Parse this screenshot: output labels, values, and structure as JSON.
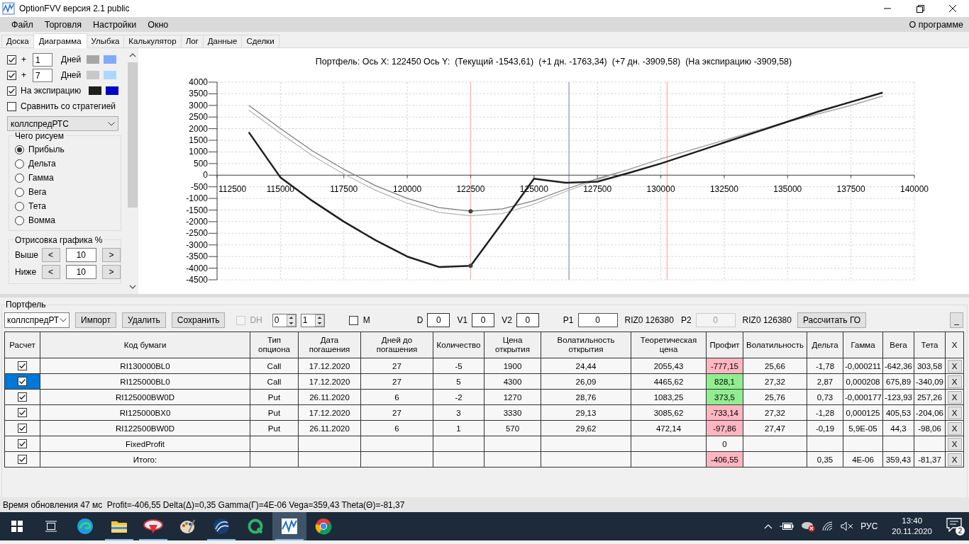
{
  "window": {
    "title": "OptionFVV версия 2.1 public"
  },
  "menu": {
    "items": [
      "Файл",
      "Торговля",
      "Настройки",
      "Окно"
    ],
    "about": "О программе"
  },
  "tabs": [
    {
      "label": "Доска",
      "selected": false
    },
    {
      "label": "Диаграмма",
      "selected": true
    },
    {
      "label": "Улыбка",
      "selected": false
    },
    {
      "label": "Калькулятор",
      "selected": false
    },
    {
      "label": "Лог",
      "selected": false
    },
    {
      "label": "Данные",
      "selected": false
    },
    {
      "label": "Сделки",
      "selected": false
    }
  ],
  "sidebar": {
    "horizons": [
      {
        "checked": true,
        "prefix": "+",
        "days": "1",
        "unit": "Дней",
        "swatches": [
          {
            "color": "#a6a6a6"
          },
          {
            "color": "#80aaff"
          }
        ]
      },
      {
        "checked": true,
        "prefix": "+",
        "days": "7",
        "unit": "Дней",
        "swatches": [
          {
            "color": "#c8c8c8"
          },
          {
            "color": "#aad8ff"
          }
        ]
      }
    ],
    "expiration": {
      "checked": true,
      "label": "На экспирацию",
      "swatches": [
        {
          "color": "#1e1e1e"
        },
        {
          "color": "#0000c8"
        }
      ]
    },
    "compare": {
      "checked": false,
      "label": "Сравнить со стратегией"
    },
    "strategy_select": {
      "value": "коллспредРТС"
    },
    "draw_group": {
      "title": "Чего рисуем",
      "options": [
        {
          "label": "Прибыль",
          "selected": true
        },
        {
          "label": "Дельта",
          "selected": false
        },
        {
          "label": "Гамма",
          "selected": false
        },
        {
          "label": "Вега",
          "selected": false
        },
        {
          "label": "Тета",
          "selected": false
        },
        {
          "label": "Вомма",
          "selected": false
        }
      ]
    },
    "range_group": {
      "title": "Отрисовка графика %",
      "rows": [
        {
          "label": "Выше",
          "dec": "<",
          "value": "10",
          "inc": ">"
        },
        {
          "label": "Ниже",
          "dec": "<",
          "value": "10",
          "inc": ">"
        }
      ]
    }
  },
  "chart": {
    "title": "Портфель: Ось X: 122450 Ось Y:  (Текущий -1543,61)  (+1 дн. -1763,34)  (+7 дн. -3909,58)  (На экспирацию -3909,58)",
    "chart_data": {
      "type": "line",
      "x": [
        113750,
        115000,
        116250,
        117500,
        118750,
        120000,
        121250,
        122500,
        123750,
        125000,
        126250,
        127500,
        128750,
        130000,
        131250,
        132500,
        133750,
        135000,
        136250,
        137500,
        138750
      ],
      "series": [
        {
          "color": "#7a7a7a",
          "values": [
            3000,
            2000,
            1050,
            250,
            -450,
            -1000,
            -1400,
            -1550,
            -1450,
            -1100,
            -600,
            -150,
            250,
            700,
            1100,
            1500,
            1900,
            2300,
            2650,
            3000,
            3400
          ]
        },
        {
          "color": "#b4b4b4",
          "values": [
            2800,
            1800,
            850,
            50,
            -650,
            -1200,
            -1600,
            -1750,
            -1650,
            -1250,
            -700,
            -200,
            250,
            700,
            1100,
            1500,
            1900,
            2300,
            2650,
            3000,
            3400
          ]
        },
        {
          "color": "#1e1e1e",
          "values": [
            1850,
            -100,
            -1100,
            -2000,
            -2800,
            -3500,
            -3950,
            -3900,
            -2050,
            -150,
            -330,
            -280,
            100,
            500,
            950,
            1400,
            1850,
            2300,
            2750,
            3150,
            3550
          ]
        }
      ],
      "xlim": [
        112500,
        140000
      ],
      "ylim": [
        -4500,
        4000
      ],
      "xticks": [
        112500,
        115000,
        117500,
        120000,
        122500,
        125000,
        127500,
        130000,
        132500,
        135000,
        137500,
        140000
      ],
      "yticks": [
        4000,
        3500,
        3000,
        2500,
        2000,
        1500,
        1000,
        500,
        0,
        -500,
        -1000,
        -1500,
        -2000,
        -2500,
        -3000,
        -3500,
        -4000,
        -4500
      ],
      "grid": true,
      "ref_lines": [
        {
          "axis": "x",
          "value": 122500,
          "color": "#ffb4b4"
        },
        {
          "axis": "x",
          "value": 126380,
          "color": "#a0a8c0"
        },
        {
          "axis": "x",
          "value": 130250,
          "color": "#ffb4b4"
        }
      ]
    }
  },
  "portfolio": {
    "title": "Портфель",
    "strategy": "коллспредРТ",
    "buttons": [
      "Импорт",
      "Удалить",
      "Сохранить"
    ],
    "dh": {
      "label": "DH",
      "checked": false,
      "disabled": true
    },
    "spinners": [
      "0",
      "1"
    ],
    "m": {
      "label": "M",
      "checked": false
    },
    "fields": [
      {
        "label": "D",
        "value": "0",
        "disabled": false
      },
      {
        "label": "V1",
        "value": "0",
        "disabled": false
      },
      {
        "label": "V2",
        "value": "0",
        "disabled": false
      },
      {
        "label": "P1",
        "value": "0",
        "disabled": false,
        "suffix": "RIZ0 126380"
      },
      {
        "label": "P2",
        "value": "0",
        "disabled": true,
        "suffix": "RIZ0 126380"
      }
    ],
    "calc_button": "Рассчитать ГО",
    "collapse_button": "_",
    "table": {
      "check_column": "Расчет",
      "columns": [
        "Код бумаги",
        "Тип опциона",
        "Дата погашения",
        "Дней до погашения",
        "Количество",
        "Цена открытия",
        "Волатильность открытия",
        "Теоретическая цена",
        "Профит",
        "Волатильность",
        "Дельта",
        "Гамма",
        "Вега",
        "Тета"
      ],
      "remove_column": "X",
      "rows": [
        {
          "checked": true,
          "selected": false,
          "color": "#ffb6c1",
          "cells": [
            "RI130000BL0",
            "Call",
            "17.12.2020",
            "27",
            "-5",
            "1900",
            "24,44",
            "2055,43",
            "-777,15",
            "25,66",
            "-1,78",
            "-0,000211",
            "-642,36",
            "303,58"
          ],
          "remove": "X"
        },
        {
          "checked": true,
          "selected": true,
          "color": "#90ee90",
          "cells": [
            "RI125000BL0",
            "Call",
            "17.12.2020",
            "27",
            "5",
            "4300",
            "26,09",
            "4465,62",
            "828,1",
            "27,32",
            "2,87",
            "0,000208",
            "675,89",
            "-340,09"
          ],
          "remove": "X"
        },
        {
          "checked": true,
          "selected": false,
          "color": "#90ee90",
          "cells": [
            "RI125000BW0D",
            "Put",
            "26.11.2020",
            "6",
            "-2",
            "1270",
            "28,76",
            "1083,25",
            "373,5",
            "25,76",
            "0,73",
            "-0,000177",
            "-123,93",
            "257,26"
          ],
          "remove": "X"
        },
        {
          "checked": true,
          "selected": false,
          "color": "#ffb6c1",
          "cells": [
            "RI125000BX0",
            "Put",
            "17.12.2020",
            "27",
            "3",
            "3330",
            "29,13",
            "3085,62",
            "-733,14",
            "27,32",
            "-1,28",
            "0,000125",
            "405,53",
            "-204,06"
          ],
          "remove": "X"
        },
        {
          "checked": true,
          "selected": false,
          "color": "#ffb6c1",
          "cells": [
            "RI122500BW0D",
            "Put",
            "26.11.2020",
            "6",
            "1",
            "570",
            "29,62",
            "472,14",
            "-97,86",
            "27,47",
            "-0,19",
            "5,9E-05",
            "44,3",
            "-98,06"
          ],
          "remove": "X"
        },
        {
          "checked": true,
          "selected": false,
          "cells": [
            "FixedProfit",
            "",
            "",
            "",
            "",
            "",
            "",
            "",
            "0",
            "",
            "",
            "",
            "",
            ""
          ],
          "remove": "X"
        },
        {
          "checked": true,
          "selected": false,
          "color": "#ffb6c1",
          "cells": [
            "Итого:",
            "",
            "",
            "",
            "",
            "",
            "",
            "",
            "-406,55",
            "",
            "0,35",
            "4E-06",
            "359,43",
            "-81,37"
          ],
          "remove": "X"
        }
      ]
    }
  },
  "status_bar": {
    "text": "Время обновления 47 мс  Profit=-406,55 Delta(Δ)=0,35 Gamma(Γ)=4E-06 Vega=359,43 Theta(Θ)=-81,37"
  },
  "taskbar": {
    "apps": [
      {
        "kind": "start",
        "running": false,
        "active": false
      },
      {
        "kind": "taskview",
        "running": false,
        "active": false
      },
      {
        "kind": "swirl",
        "running": false,
        "active": false
      },
      {
        "kind": "folder",
        "running": true,
        "active": false
      },
      {
        "kind": "ellipse",
        "running": true,
        "active": false
      },
      {
        "kind": "palette",
        "running": false,
        "active": false
      },
      {
        "kind": "globe",
        "running": true,
        "active": false
      },
      {
        "kind": "ring",
        "running": false,
        "active": false
      },
      {
        "kind": "chart",
        "running": true,
        "active": true
      },
      {
        "kind": "circle",
        "running": false,
        "active": false
      }
    ],
    "language": "РУС",
    "time": "13:40",
    "date": "20.11.2020",
    "notifications": "2"
  }
}
